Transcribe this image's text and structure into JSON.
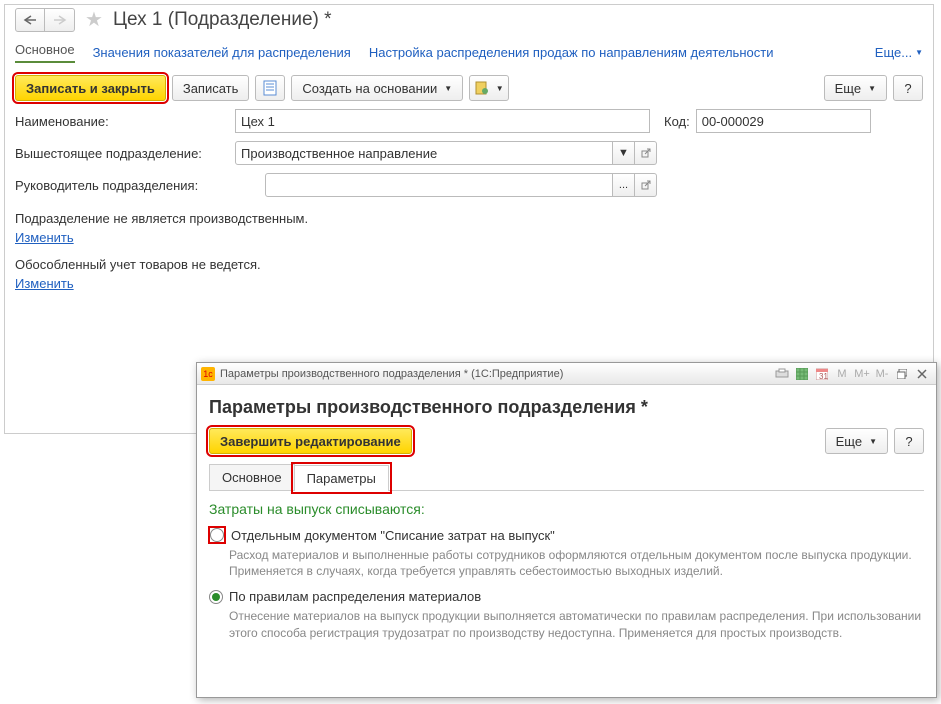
{
  "header": {
    "title": "Цех 1 (Подразделение) *"
  },
  "tabs": {
    "main": "Основное",
    "indicators": "Значения показателей для распределения",
    "settings": "Настройка распределения продаж по направлениям деятельности",
    "more": "Еще..."
  },
  "toolbar": {
    "save_close": "Записать и закрыть",
    "save": "Записать",
    "create_based": "Создать на основании",
    "more": "Еще",
    "help": "?"
  },
  "form": {
    "name_label": "Наименование:",
    "name_value": "Цех 1",
    "code_label": "Код:",
    "code_value": "00-000029",
    "parent_label": "Вышестоящее подразделение:",
    "parent_value": "Производственное направление",
    "head_label": "Руководитель подразделения:",
    "head_value": "",
    "ellipsis": "..."
  },
  "info": {
    "not_production": "Подразделение не является производственным.",
    "change1": "Изменить",
    "no_separate": "Обособленный учет товаров не ведется.",
    "change2": "Изменить"
  },
  "popup": {
    "titlebar": "Параметры производственного подразделения * (1С:Предприятие)",
    "title": "Параметры производственного подразделения *",
    "finish": "Завершить редактирование",
    "more": "Еще",
    "help": "?",
    "tabs": {
      "main": "Основное",
      "params": "Параметры"
    },
    "section": "Затраты на выпуск списываются:",
    "option1_label": "Отдельным документом \"Списание затрат на выпуск\"",
    "option1_desc": "Расход материалов и выполненные работы сотрудников оформляются отдельным документом после выпуска продукции. Применяется в случаях, когда требуется управлять себестоимостью выходных изделий.",
    "option2_label": "По правилам распределения материалов",
    "option2_desc": "Отнесение материалов на выпуск продукции выполняется автоматически по правилам распределения. При использовании этого способа регистрация трудозатрат по производству недоступна. Применяется для простых производств.",
    "tb_m": "M",
    "tb_mp": "M+",
    "tb_mm": "M-"
  }
}
